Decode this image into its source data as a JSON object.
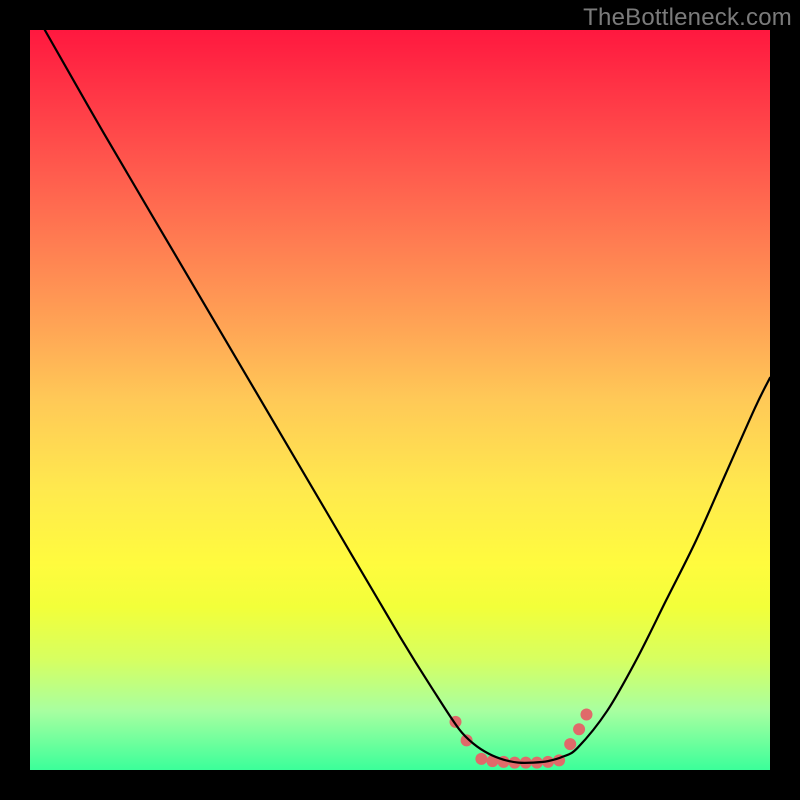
{
  "watermark": "TheBottleneck.com",
  "chart_data": {
    "type": "line",
    "title": "",
    "xlabel": "",
    "ylabel": "",
    "xlim": [
      0,
      100
    ],
    "ylim": [
      0,
      100
    ],
    "series": [
      {
        "name": "curve",
        "color": "#000000",
        "x": [
          2,
          10,
          20,
          30,
          40,
          50,
          55,
          58,
          60,
          62,
          64,
          66,
          68,
          70,
          72,
          74,
          78,
          82,
          86,
          90,
          94,
          98,
          100
        ],
        "y": [
          100,
          86,
          69,
          52,
          35,
          18,
          10,
          5.5,
          3.5,
          2.2,
          1.4,
          1.0,
          1.0,
          1.2,
          1.8,
          3.0,
          8,
          15,
          23,
          31,
          40,
          49,
          53
        ]
      }
    ],
    "markers": {
      "name": "highlight-dots",
      "color": "#e06a6a",
      "radius_px": 6,
      "points": [
        {
          "x": 57.5,
          "y": 6.5
        },
        {
          "x": 59.0,
          "y": 4.0
        },
        {
          "x": 61.0,
          "y": 1.5
        },
        {
          "x": 62.5,
          "y": 1.2
        },
        {
          "x": 64.0,
          "y": 1.1
        },
        {
          "x": 65.5,
          "y": 1.0
        },
        {
          "x": 67.0,
          "y": 1.0
        },
        {
          "x": 68.5,
          "y": 1.0
        },
        {
          "x": 70.0,
          "y": 1.1
        },
        {
          "x": 71.5,
          "y": 1.3
        },
        {
          "x": 73.0,
          "y": 3.5
        },
        {
          "x": 74.2,
          "y": 5.5
        },
        {
          "x": 75.2,
          "y": 7.5
        }
      ]
    }
  }
}
